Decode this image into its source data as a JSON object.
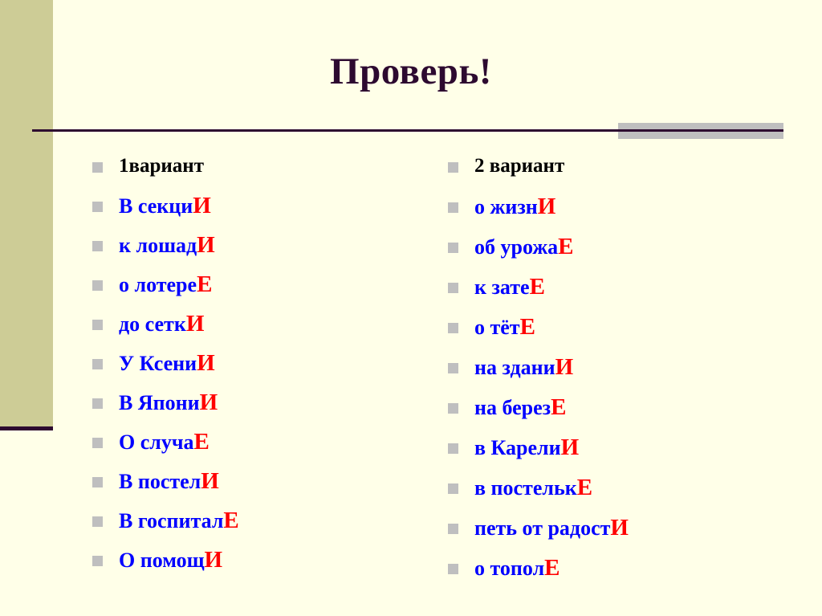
{
  "slide": {
    "title": "Проверь!",
    "background_color": "#FFFFE8",
    "title_color": "#2D0A30",
    "accent_band_color": "#CDCC96",
    "accent_bar_color": "#BFBFBF",
    "rule_color": "#2D0A30",
    "bullet_color": "#BFBFBF",
    "stem_color": "#0000FF",
    "ending_color": "#FF0000"
  },
  "columns": [
    {
      "id": "variant-1",
      "heading": "1вариант",
      "items": [
        {
          "stem": "В секци",
          "ending": "И"
        },
        {
          "stem": "к лошад",
          "ending": "И"
        },
        {
          "stem": "о лотере",
          "ending": "Е"
        },
        {
          "stem": "до сетк",
          "ending": "И"
        },
        {
          "stem": "У Ксени",
          "ending": "И"
        },
        {
          "stem": "В Япони",
          "ending": "И"
        },
        {
          "stem": "О случа",
          "ending": "Е"
        },
        {
          "stem": "В постел",
          "ending": "И"
        },
        {
          "stem": "В госпитал",
          "ending": "Е"
        },
        {
          "stem": "О помощ",
          "ending": "И"
        }
      ]
    },
    {
      "id": "variant-2",
      "heading": "2 вариант",
      "items": [
        {
          "stem": "о жизн",
          "ending": "И"
        },
        {
          "stem": "об урожа",
          "ending": "Е"
        },
        {
          "stem": "к зате",
          "ending": "Е"
        },
        {
          "stem": "о тёт",
          "ending": "Е"
        },
        {
          "stem": "на здани",
          "ending": "И"
        },
        {
          "stem": "на берез",
          "ending": "Е"
        },
        {
          "stem": "в Карели",
          "ending": "И"
        },
        {
          "stem": "в постельк",
          "ending": "Е"
        },
        {
          "stem": "петь от радост",
          "ending": "И"
        },
        {
          "stem": "о топол",
          "ending": "Е"
        }
      ]
    }
  ]
}
